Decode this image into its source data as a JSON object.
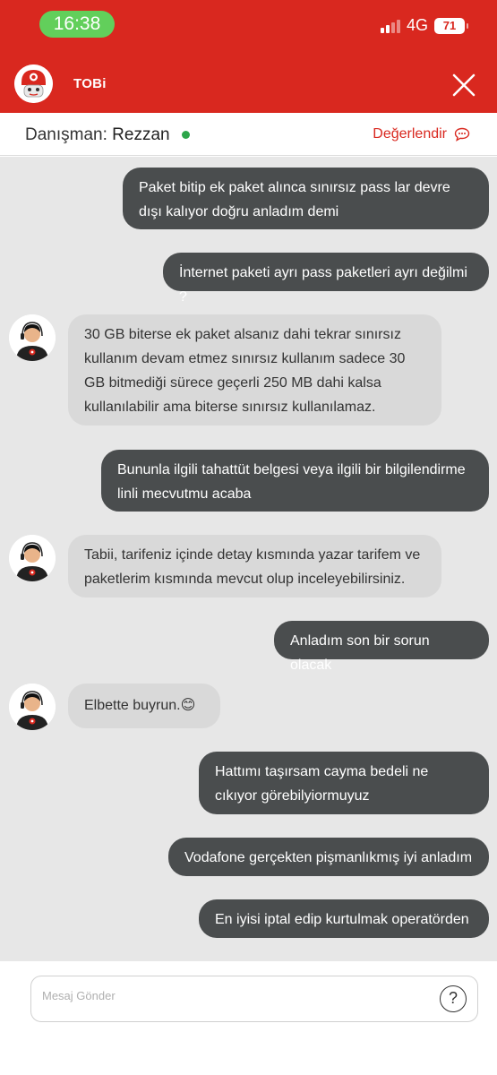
{
  "status_bar": {
    "time": "16:38",
    "network": "4G",
    "battery": "71"
  },
  "header": {
    "title": "TOBi"
  },
  "advisor": {
    "label": "Danışman:",
    "name": "Rezzan",
    "rate_label": "Değerlendir"
  },
  "messages": [
    {
      "from": "user",
      "text": "Paket bitip ek paket alınca sınırsız pass lar devre dışı kalıyor doğru anladım demi"
    },
    {
      "from": "user",
      "text": "İnternet paketi ayrı pass paketleri ayrı değilmi ?"
    },
    {
      "from": "agent",
      "text": "30 GB biterse ek paket alsanız dahi tekrar sınırsız kullanım devam etmez sınırsız kullanım sadece 30 GB bitmediği sürece geçerli 250 MB dahi kalsa kullanılabilir ama biterse sınırsız kullanılamaz."
    },
    {
      "from": "user",
      "text": "Bununla ilgili tahattüt belgesi veya ilgili bir bilgilendirme linli mecvutmu acaba"
    },
    {
      "from": "agent",
      "text": "Tabii, tarifeniz içinde detay kısmında yazar tarifem ve paketlerim kısmında mevcut olup inceleyebilirsiniz."
    },
    {
      "from": "user",
      "text": "Anladım son bir sorun olacak"
    },
    {
      "from": "agent",
      "text": "Elbette buyrun.😊"
    },
    {
      "from": "user",
      "text": "Hattımı taşırsam cayma bedeli ne cıkıyor görebilyiormuyuz"
    },
    {
      "from": "user",
      "text": "Vodafone gerçekten pişmanlıkmış iyi anladım"
    },
    {
      "from": "user",
      "text": "En iyisi iptal edip kurtulmak operatörden"
    }
  ],
  "input": {
    "placeholder": "Mesaj Gönder",
    "help_symbol": "?"
  },
  "colors": {
    "brand_red": "#d9281f",
    "user_bubble": "#4a4d4e",
    "agent_bubble": "#d9d9d9",
    "chat_bg": "#e7e7e7",
    "online": "#2da64a"
  }
}
